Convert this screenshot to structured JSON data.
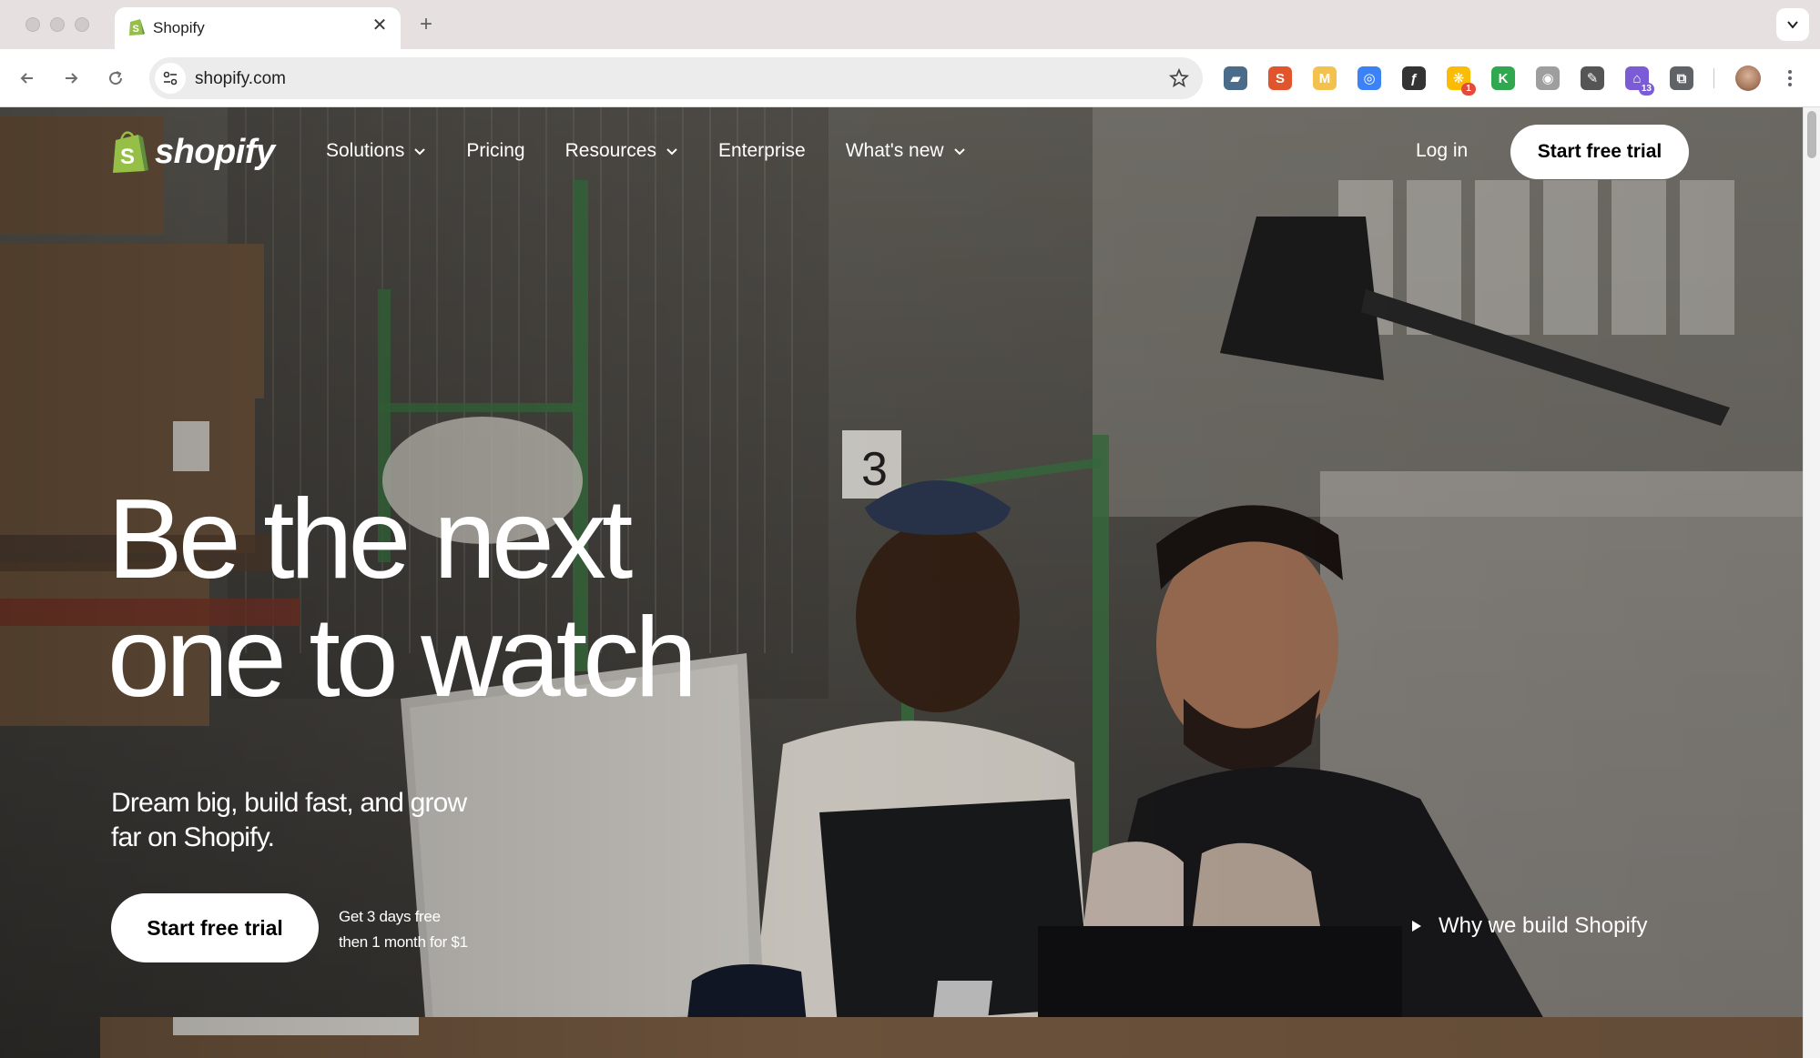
{
  "browser": {
    "tab": {
      "title": "Shopify",
      "close": "✕"
    },
    "new_tab": "+",
    "url": "shopify.com",
    "extensions": [
      {
        "name": "briefcase-extension",
        "glyph": "▰",
        "color": "#4a6b8a"
      },
      {
        "name": "s-extension",
        "glyph": "S",
        "color": "#e0552b"
      },
      {
        "name": "m-extension",
        "glyph": "M",
        "color": "#f2c14e"
      },
      {
        "name": "circle-extension",
        "glyph": "◎",
        "color": "#3b82f6"
      },
      {
        "name": "f-extension",
        "glyph": "ƒ",
        "color": "#333333"
      },
      {
        "name": "multicolor-extension",
        "glyph": "❋",
        "color": "#fbbc05",
        "badge": "1",
        "badge_color": "#e54b3c"
      },
      {
        "name": "k-extension",
        "glyph": "K",
        "color": "#2fa84f"
      },
      {
        "name": "grey-extension",
        "glyph": "◉",
        "color": "#9e9e9e"
      },
      {
        "name": "pen-extension",
        "glyph": "✎",
        "color": "#555555"
      },
      {
        "name": "cap-extension",
        "glyph": "⌂",
        "color": "#7b5cd6",
        "badge": "13",
        "badge_color": "#7b5cd6"
      },
      {
        "name": "puzzle-extension",
        "glyph": "⧉",
        "color": "#5f6368"
      }
    ]
  },
  "nav": {
    "logo": "shopify",
    "items": [
      {
        "label": "Solutions",
        "dropdown": true
      },
      {
        "label": "Pricing",
        "dropdown": false
      },
      {
        "label": "Resources",
        "dropdown": true
      },
      {
        "label": "Enterprise",
        "dropdown": false
      },
      {
        "label": "What's new",
        "dropdown": true
      }
    ],
    "login": "Log in",
    "cta": "Start free trial"
  },
  "hero": {
    "headline_line1": "Be the next",
    "headline_line2": "one to watch",
    "subhead_line1": "Dream big, build fast, and grow",
    "subhead_line2": "far on Shopify.",
    "cta": "Start free trial",
    "offer_line1": "Get 3 days free",
    "offer_line2": "then 1 month for $1",
    "video_link": "Why we build Shopify"
  },
  "colors": {
    "brand_green": "#95bf47",
    "accent_dark": "#5e8e3e"
  }
}
